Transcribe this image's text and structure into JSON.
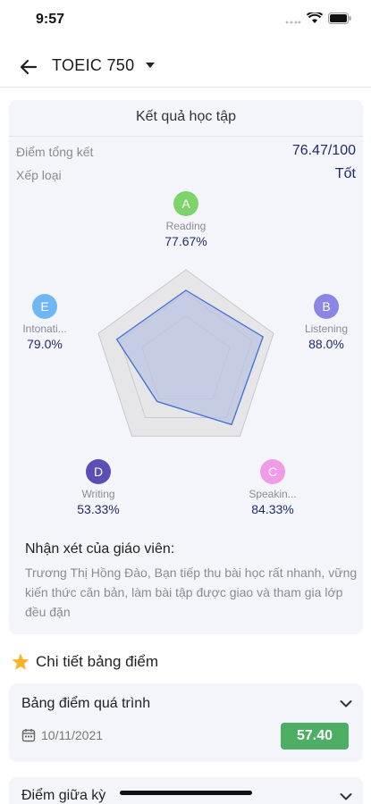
{
  "status_bar": {
    "time": "9:57"
  },
  "nav": {
    "title": "TOEIC 750"
  },
  "result": {
    "title": "Kết quả học tập",
    "final_score_label": "Điểm tổng kết",
    "final_score_value": "76.47/100",
    "rank_label": "Xếp loại",
    "rank_value": "Tốt"
  },
  "skills": [
    {
      "letter": "A",
      "name": "Reading",
      "percent": "77.67%",
      "value": 77.67,
      "color": "#7ed36b"
    },
    {
      "letter": "B",
      "name": "Listening",
      "percent": "88.0%",
      "value": 88.0,
      "color": "#8b86e3"
    },
    {
      "letter": "C",
      "name": "Speakin...",
      "percent": "84.33%",
      "value": 84.33,
      "color": "#f19ae8"
    },
    {
      "letter": "D",
      "name": "Writing",
      "percent": "53.33%",
      "value": 53.33,
      "color": "#5a4fb3"
    },
    {
      "letter": "E",
      "name": "Intonati...",
      "percent": "79.0%",
      "value": 79.0,
      "color": "#6fb6f2"
    }
  ],
  "radar_colors": {
    "grid_fill": "#e6e6e8",
    "grid_stroke": "#c9c9cc",
    "data_fill": "#b9c3e3",
    "data_stroke": "#3f6fd6"
  },
  "teacher": {
    "title": "Nhận xét của giáo viên:",
    "comment": "Trương Thị Hồng Đào,   Bạn tiếp thu bài học rất nhanh, vững kiến thức căn bản, làm bài tập được giao và tham gia lớp đều đặn"
  },
  "details": {
    "title": "Chi tiết bảng điểm",
    "icon": "star-icon",
    "process": {
      "title": "Bảng điểm quá trình",
      "date": "10/11/2021",
      "score": "57.40"
    },
    "midterm": {
      "title": "Điểm giữa kỳ"
    }
  }
}
